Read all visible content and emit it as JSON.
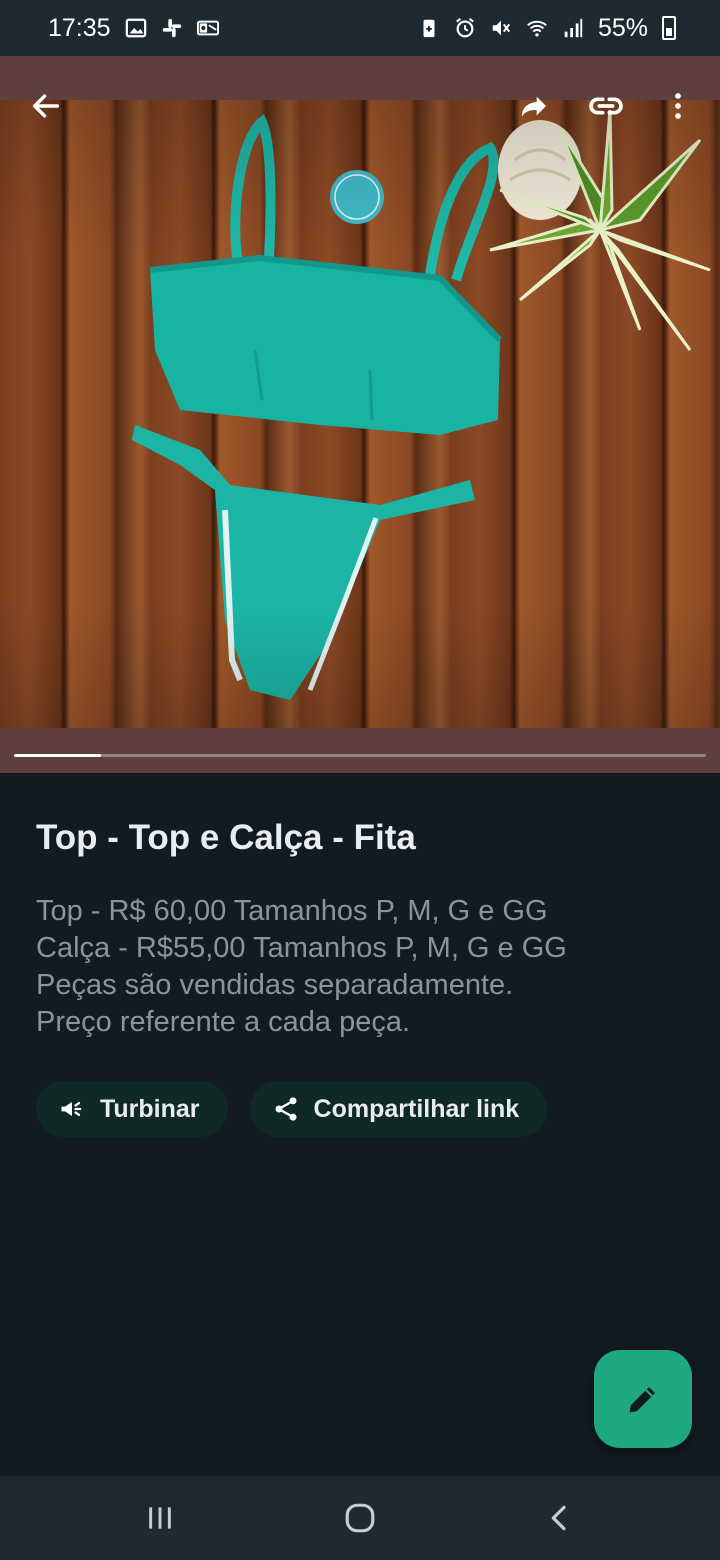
{
  "status_bar": {
    "time": "17:35",
    "battery_percent": "55%",
    "left_icons": [
      "gallery-icon",
      "slack-icon",
      "outlook-icon"
    ],
    "right_icons": [
      "battery-saver-icon",
      "alarm-icon",
      "mute-icon",
      "wifi-icon",
      "signal-icon",
      "battery-icon"
    ]
  },
  "media": {
    "background_color": "#5f3f3b",
    "progress": 0.125,
    "top_bar_icons": [
      "back-arrow-icon",
      "forward-icon",
      "link-icon",
      "more-options-icon"
    ]
  },
  "product": {
    "title": "Top - Top e Calça - Fita",
    "description_lines": [
      "Top - R$ 60,00 Tamanhos P, M, G e GG",
      "Calça - R$55,00 Tamanhos P, M, G e GG",
      "Peças são vendidas separadamente.",
      "Preço referente a cada peça."
    ]
  },
  "actions": {
    "boost_label": "Turbinar",
    "share_label": "Compartilhar link"
  },
  "colors": {
    "background": "#111b21",
    "chip_background": "#0f2a26",
    "fab": "#1fa87f",
    "title_text": "#e9edef",
    "description_text": "#8696a0"
  },
  "nav_bar": {
    "icons": [
      "recents-icon",
      "home-icon",
      "back-icon"
    ]
  }
}
